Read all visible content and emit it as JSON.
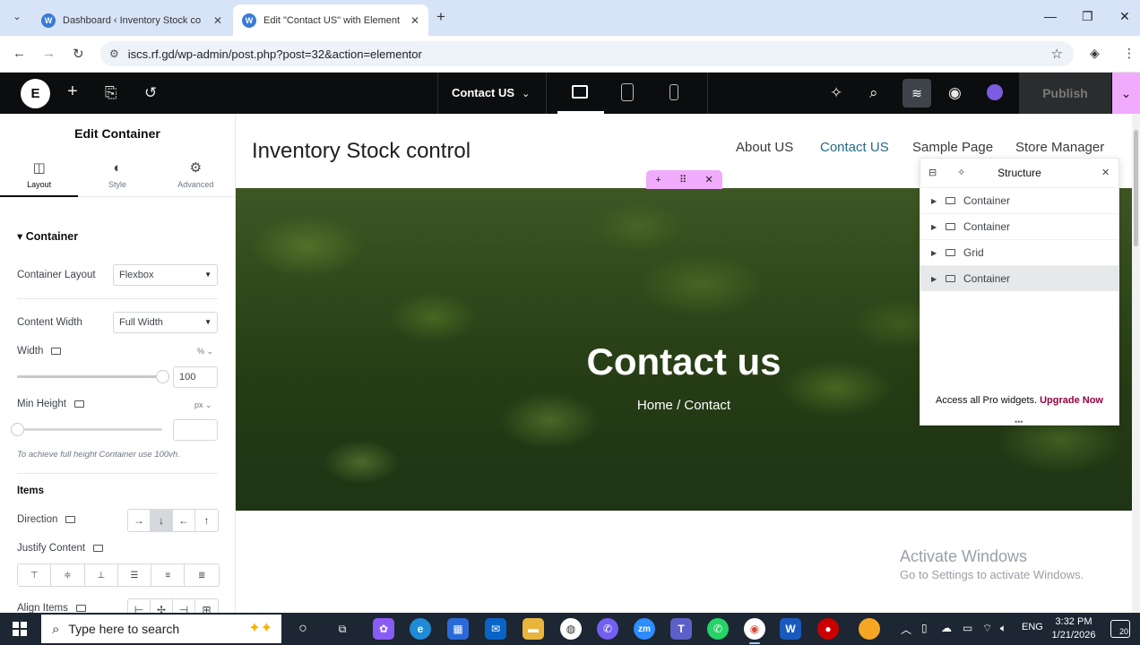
{
  "browser": {
    "tabs": [
      {
        "title": "Dashboard ‹ Inventory Stock co",
        "active": false
      },
      {
        "title": "Edit \"Contact US\" with Element",
        "active": true
      }
    ],
    "url": "iscs.rf.gd/wp-admin/post.php?post=32&action=elementor"
  },
  "editor": {
    "logo_letter": "E",
    "page_name": "Contact US",
    "publish_label": "Publish",
    "colors": {
      "accent_pink": "#f0abfc",
      "bar_bg": "#0c0d0e",
      "ai_purple": "#7c5ce0",
      "upgrade": "#93003c"
    }
  },
  "panel": {
    "title": "Edit Container",
    "tabs": [
      {
        "label": "Layout",
        "icon": "layout-icon",
        "active": true
      },
      {
        "label": "Style",
        "icon": "style-icon",
        "active": false
      },
      {
        "label": "Advanced",
        "icon": "gear-icon",
        "active": false
      }
    ],
    "section": "Container",
    "container_layout_label": "Container Layout",
    "container_layout_value": "Flexbox",
    "content_width_label": "Content Width",
    "content_width_value": "Full Width",
    "width_label": "Width",
    "width_unit": "%",
    "width_value": "100",
    "min_height_label": "Min Height",
    "min_height_unit": "px",
    "min_height_value": "",
    "hint": "To achieve full height Container use 100vh.",
    "items_label": "Items",
    "direction_label": "Direction",
    "direction_options": [
      "→",
      "↓",
      "←",
      "↑"
    ],
    "justify_label": "Justify Content",
    "align_label": "Align Items"
  },
  "site": {
    "title": "Inventory Stock control",
    "nav": [
      "About US",
      "Contact US",
      "Sample Page",
      "Store Manager"
    ],
    "active_nav": "Contact US",
    "hero_title": "Contact us",
    "breadcrumb": "Home / Contact"
  },
  "structure": {
    "title": "Structure",
    "items": [
      {
        "label": "Container",
        "icon": "container-icon",
        "selected": false
      },
      {
        "label": "Container",
        "icon": "container-icon",
        "selected": false
      },
      {
        "label": "Grid",
        "icon": "grid-icon",
        "selected": false
      },
      {
        "label": "Container",
        "icon": "container-icon",
        "selected": true
      }
    ],
    "footer_text": "Access all Pro widgets.",
    "upgrade_link": "Upgrade Now"
  },
  "watermark": {
    "title": "Activate Windows",
    "subtitle": "Go to Settings to activate Windows."
  },
  "taskbar": {
    "search_placeholder": "Type here to search",
    "time": "3:32 PM",
    "date": "1/21/2026",
    "lang": "ENG",
    "notification_count": "20"
  }
}
